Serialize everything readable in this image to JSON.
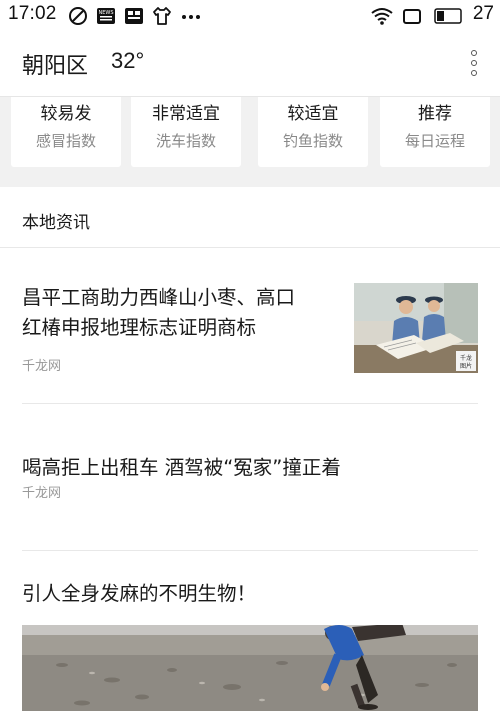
{
  "status_bar": {
    "time": "17:02",
    "battery": "27",
    "icons": [
      "alarm-icon",
      "news-app-icon",
      "doc-app-icon",
      "shirt-icon",
      "more-dots-icon",
      "wifi-icon",
      "screen-icon",
      "battery-icon"
    ]
  },
  "header": {
    "location": "朝阳区",
    "temperature": "32°",
    "menu_icon": "more-vertical-icon"
  },
  "indices": [
    {
      "value": "较易发",
      "label": "感冒指数"
    },
    {
      "value": "非常适宜",
      "label": "洗车指数"
    },
    {
      "value": "较适宜",
      "label": "钓鱼指数"
    },
    {
      "value": "推荐",
      "label": "每日运程"
    }
  ],
  "section": {
    "title": "本地资讯"
  },
  "news": [
    {
      "title_line1": "昌平工商助力西峰山小枣、高口",
      "title_line2": "红椿申报地理标志证明商标",
      "source": "千龙网"
    },
    {
      "title": "喝高拒上出租车 酒驾被“冤家”撞正着",
      "source": "千龙网"
    },
    {
      "title": "引人全身发麻的不明生物！"
    }
  ],
  "colors": {
    "background": "#ffffff",
    "gray_area": "#f1f1f1",
    "secondary_text": "#8a8a8a"
  }
}
